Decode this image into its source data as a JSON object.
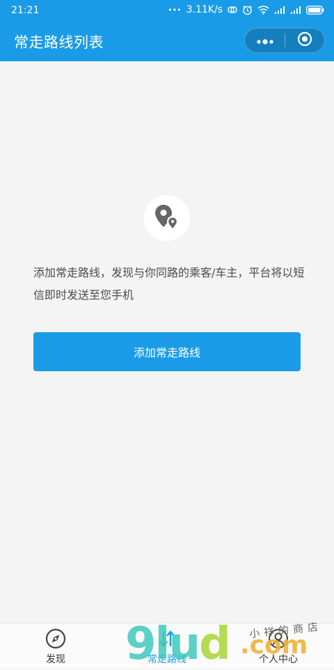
{
  "colors": {
    "primary": "#1a9be8",
    "background": "#f4f4f4",
    "text": "#4a4a4a",
    "tab_inactive": "#333333",
    "watermark_teal": "#3fc9bd",
    "watermark_green": "#a8d636",
    "watermark_orange": "#f0b13a"
  },
  "status_bar": {
    "time": "21:21",
    "dots": "•••",
    "network_speed": "3.11K/s",
    "icons": [
      "sync-icon",
      "alarm-icon",
      "wifi-icon",
      "signal-icon",
      "signal-icon",
      "battery-icon"
    ]
  },
  "header": {
    "title": "常走路线列表",
    "more_icon": "more-dots-icon",
    "close_icon": "target-circle-icon"
  },
  "empty_state": {
    "icon": "location-pin-pair-icon",
    "description": "添加常走路线，发现与你同路的乘客/车主，平台将以短信即时发送至您手机",
    "button_label": "添加常走路线"
  },
  "tabbar": {
    "tabs": [
      {
        "label": "发现",
        "icon": "compass-icon",
        "active": false
      },
      {
        "label": "常走路线",
        "icon": "route-arrows-icon",
        "active": true
      },
      {
        "label": "",
        "icon": "",
        "active": false
      },
      {
        "label": "个人中心",
        "icon": "person-icon",
        "active": false
      }
    ]
  },
  "watermark": {
    "logo": "9lud",
    "domain": ".com",
    "slogan": "小祥的商店"
  }
}
